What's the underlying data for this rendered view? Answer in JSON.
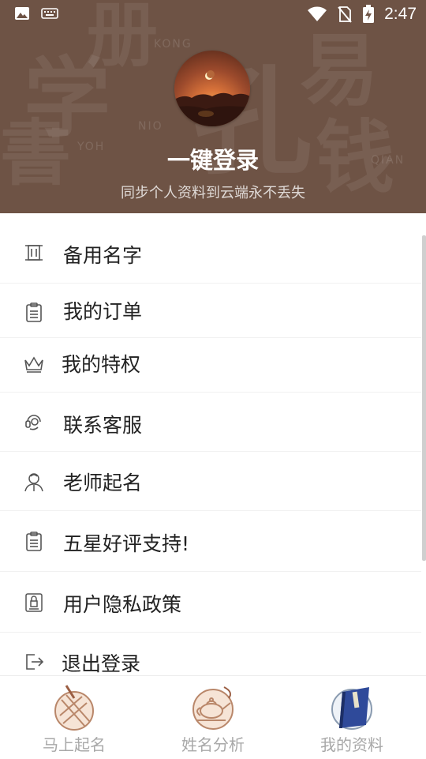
{
  "status_bar": {
    "time": "2:47"
  },
  "header": {
    "login_title": "一键登录",
    "login_subtitle": "同步个人资料到云端永不丢失"
  },
  "menu": {
    "items": [
      {
        "label": "备用名字",
        "icon": "scroll-icon"
      },
      {
        "label": "我的订单",
        "icon": "clipboard-icon"
      },
      {
        "label": "我的特权",
        "icon": "crown-icon"
      },
      {
        "label": "联系客服",
        "icon": "headset-icon"
      },
      {
        "label": "老师起名",
        "icon": "teacher-icon"
      },
      {
        "label": "五星好评支持!",
        "icon": "clipboard-icon"
      },
      {
        "label": "用户隐私政策",
        "icon": "privacy-lock-icon"
      },
      {
        "label": "退出登录",
        "icon": "logout-icon"
      }
    ]
  },
  "tabbar": {
    "tabs": [
      {
        "label": "马上起名",
        "icon": "brush-seal-icon",
        "active": false
      },
      {
        "label": "姓名分析",
        "icon": "teapot-icon",
        "active": false
      },
      {
        "label": "我的资料",
        "icon": "book-icon",
        "active": true
      }
    ]
  },
  "colors": {
    "header_bg": "#6e5345",
    "text": "#222222",
    "tab_label": "#a8a8a8",
    "accent": "#c9a07f"
  }
}
